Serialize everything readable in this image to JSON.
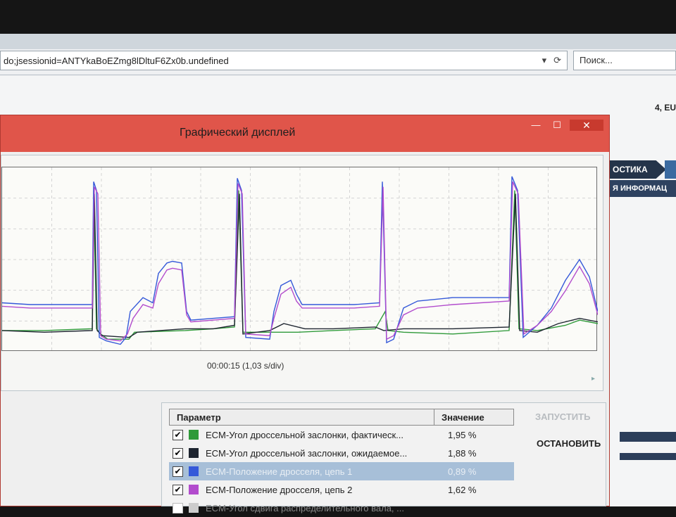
{
  "browser": {
    "url": "do;jsessionid=ANTYkaBoEZmg8lDltuF6Zx0b.undefined",
    "search_placeholder": "Поиск..."
  },
  "page": {
    "top_right_text": "4, EU",
    "tab_label": "ОСТИКА",
    "subtab_label": "Я ИНФОРМАЦ"
  },
  "dialog": {
    "title": "Графический дисплей",
    "minimize_icon": "minimize-icon",
    "maximize_icon": "maximize-icon",
    "close_icon": "close-icon",
    "close_glyph": "✕",
    "time_label": "00:00:15 (1,03 s/div)"
  },
  "params": {
    "headers": {
      "param": "Параметр",
      "value": "Значение"
    },
    "rows": [
      {
        "name": "ECM-Угол дроссельной заслонки, фактическ...",
        "value": "1,95 %",
        "color": "#2f9a3a",
        "checked": true,
        "selected": false
      },
      {
        "name": "ECM-Угол дроссельной заслонки, ожидаемое...",
        "value": "1,88 %",
        "color": "#1e2530",
        "checked": true,
        "selected": false
      },
      {
        "name": "ECM-Положение дросселя, цепь 1",
        "value": "0,89 %",
        "color": "#3559d9",
        "checked": true,
        "selected": true
      },
      {
        "name": "ECM-Положение дросселя, цепь 2",
        "value": "1,62 %",
        "color": "#b24ccd",
        "checked": true,
        "selected": false
      },
      {
        "name": "ECM-Угол сдвига распределительного вала, ...",
        "value": "",
        "color": "#cccccc",
        "checked": false,
        "selected": false
      }
    ]
  },
  "buttons": {
    "start": "ЗАПУСТИТЬ",
    "stop": "ОСТАНОВИТЬ"
  },
  "chart_data": {
    "type": "line",
    "xlabel": "00:00:15 (1,03 s/div)",
    "ylim": [
      0,
      100
    ],
    "grid": true,
    "series": [
      {
        "name": "ECM-Угол дроссельной заслонки, фактическ...",
        "color": "#2f9a3a",
        "points": [
          [
            0,
            9
          ],
          [
            60,
            9
          ],
          [
            128,
            10
          ],
          [
            130,
            90
          ],
          [
            134,
            10
          ],
          [
            140,
            7
          ],
          [
            150,
            4
          ],
          [
            180,
            4
          ],
          [
            188,
            8
          ],
          [
            260,
            9
          ],
          [
            300,
            10
          ],
          [
            330,
            11
          ],
          [
            336,
            90
          ],
          [
            342,
            8
          ],
          [
            380,
            8
          ],
          [
            420,
            8
          ],
          [
            470,
            9
          ],
          [
            530,
            10
          ],
          [
            544,
            20
          ],
          [
            548,
            9
          ],
          [
            570,
            8
          ],
          [
            640,
            7
          ],
          [
            720,
            9
          ],
          [
            728,
            90
          ],
          [
            734,
            10
          ],
          [
            760,
            9
          ],
          [
            800,
            12
          ],
          [
            820,
            15
          ],
          [
            846,
            13
          ]
        ]
      },
      {
        "name": "ECM-Угол дроссельной заслонки, ожидаемое...",
        "color": "#1e2530",
        "points": [
          [
            0,
            9
          ],
          [
            60,
            8
          ],
          [
            128,
            9
          ],
          [
            131,
            88
          ],
          [
            135,
            9
          ],
          [
            142,
            6
          ],
          [
            180,
            5
          ],
          [
            192,
            8
          ],
          [
            260,
            10
          ],
          [
            300,
            10
          ],
          [
            330,
            12
          ],
          [
            337,
            88
          ],
          [
            342,
            7
          ],
          [
            380,
            9
          ],
          [
            400,
            13
          ],
          [
            430,
            10
          ],
          [
            470,
            10
          ],
          [
            530,
            11
          ],
          [
            542,
            9
          ],
          [
            570,
            10
          ],
          [
            640,
            10
          ],
          [
            720,
            11
          ],
          [
            729,
            88
          ],
          [
            735,
            9
          ],
          [
            760,
            8
          ],
          [
            790,
            13
          ],
          [
            820,
            16
          ],
          [
            846,
            14
          ]
        ]
      },
      {
        "name": "ECM-Положение дросселя, цепь 1",
        "color": "#3559d9",
        "points": [
          [
            0,
            25
          ],
          [
            40,
            24
          ],
          [
            80,
            24
          ],
          [
            128,
            24
          ],
          [
            130,
            95
          ],
          [
            134,
            90
          ],
          [
            138,
            5
          ],
          [
            148,
            3
          ],
          [
            168,
            1
          ],
          [
            176,
            5
          ],
          [
            182,
            20
          ],
          [
            200,
            28
          ],
          [
            214,
            25
          ],
          [
            222,
            42
          ],
          [
            234,
            48
          ],
          [
            242,
            49
          ],
          [
            255,
            48
          ],
          [
            262,
            20
          ],
          [
            268,
            15
          ],
          [
            300,
            16
          ],
          [
            330,
            17
          ],
          [
            334,
            97
          ],
          [
            340,
            90
          ],
          [
            346,
            5
          ],
          [
            380,
            4
          ],
          [
            386,
            20
          ],
          [
            396,
            35
          ],
          [
            410,
            38
          ],
          [
            418,
            30
          ],
          [
            426,
            24
          ],
          [
            500,
            24
          ],
          [
            536,
            25
          ],
          [
            540,
            95
          ],
          [
            546,
            2
          ],
          [
            556,
            4
          ],
          [
            570,
            22
          ],
          [
            590,
            26
          ],
          [
            640,
            28
          ],
          [
            720,
            28
          ],
          [
            724,
            98
          ],
          [
            732,
            90
          ],
          [
            740,
            5
          ],
          [
            760,
            12
          ],
          [
            780,
            22
          ],
          [
            800,
            38
          ],
          [
            820,
            50
          ],
          [
            834,
            40
          ],
          [
            846,
            20
          ]
        ]
      },
      {
        "name": "ECM-Положение дросселя, цепь 2",
        "color": "#b24ccd",
        "points": [
          [
            0,
            23
          ],
          [
            40,
            22
          ],
          [
            80,
            22
          ],
          [
            128,
            22
          ],
          [
            131,
            92
          ],
          [
            136,
            88
          ],
          [
            140,
            6
          ],
          [
            148,
            4
          ],
          [
            168,
            3
          ],
          [
            178,
            7
          ],
          [
            186,
            16
          ],
          [
            200,
            24
          ],
          [
            214,
            22
          ],
          [
            222,
            36
          ],
          [
            234,
            44
          ],
          [
            242,
            45
          ],
          [
            255,
            44
          ],
          [
            262,
            18
          ],
          [
            268,
            14
          ],
          [
            300,
            15
          ],
          [
            330,
            16
          ],
          [
            335,
            94
          ],
          [
            341,
            88
          ],
          [
            346,
            7
          ],
          [
            380,
            6
          ],
          [
            386,
            16
          ],
          [
            396,
            30
          ],
          [
            410,
            34
          ],
          [
            418,
            26
          ],
          [
            426,
            22
          ],
          [
            500,
            22
          ],
          [
            536,
            23
          ],
          [
            541,
            92
          ],
          [
            546,
            4
          ],
          [
            556,
            6
          ],
          [
            570,
            18
          ],
          [
            590,
            22
          ],
          [
            640,
            24
          ],
          [
            720,
            26
          ],
          [
            725,
            95
          ],
          [
            733,
            88
          ],
          [
            741,
            7
          ],
          [
            760,
            12
          ],
          [
            780,
            20
          ],
          [
            800,
            32
          ],
          [
            820,
            46
          ],
          [
            834,
            36
          ],
          [
            846,
            18
          ]
        ]
      }
    ]
  }
}
